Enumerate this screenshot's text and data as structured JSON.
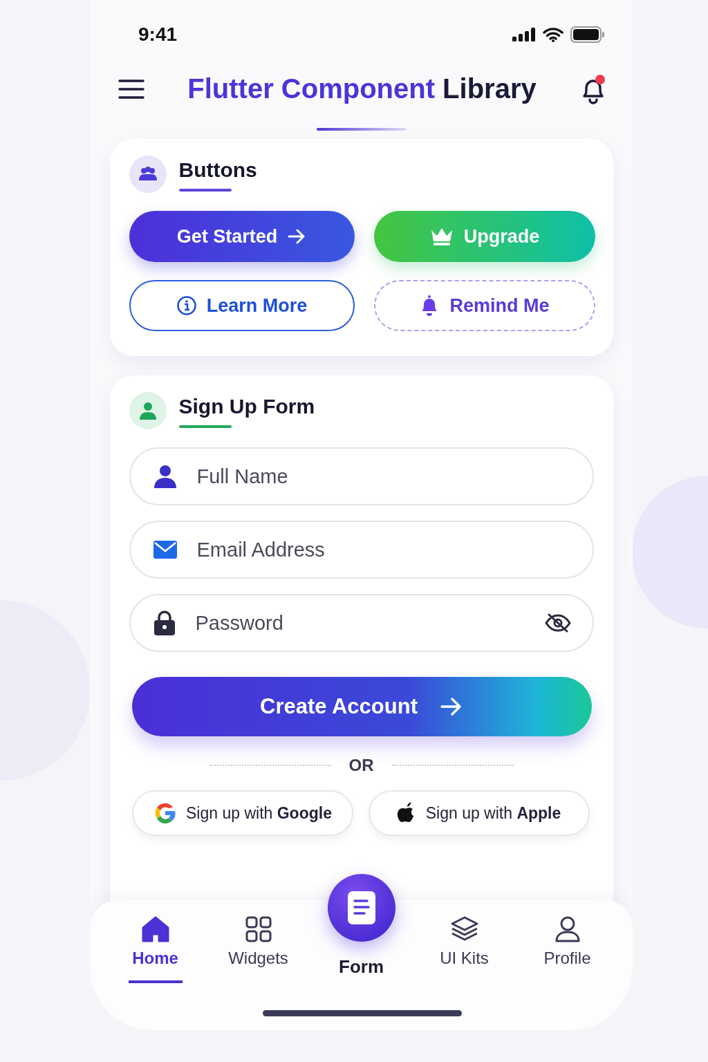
{
  "status_bar": {
    "time": "9:41"
  },
  "header": {
    "title_highlight": "Flutter Component",
    "title_rest": "Library",
    "has_notification": true
  },
  "buttons_card": {
    "title": "Buttons",
    "buttons": [
      {
        "kind": "primary",
        "label": "Get Started"
      },
      {
        "kind": "success",
        "label": "Upgrade"
      },
      {
        "kind": "outline",
        "label": "Learn More"
      },
      {
        "kind": "dashed",
        "label": "Remind Me"
      }
    ]
  },
  "signup_card": {
    "title": "Sign Up Form",
    "fields": [
      {
        "kind": "name",
        "placeholder": "Full Name"
      },
      {
        "kind": "email",
        "placeholder": "Email Address"
      },
      {
        "kind": "password",
        "placeholder": "Password"
      }
    ],
    "submit": "Create Account",
    "divider": "OR",
    "social": [
      {
        "kind": "google",
        "text": "Sign up with **Google**"
      },
      {
        "kind": "apple",
        "text": "Sign up with **Apple**"
      }
    ]
  },
  "bottom_nav": [
    {
      "kind": "home",
      "label": "Home",
      "selected": true
    },
    {
      "kind": "widgets",
      "label": "Widgets",
      "selected": false
    },
    {
      "kind": "fab",
      "label": "Form",
      "selected": false
    },
    {
      "kind": "kits",
      "label": "UI Kits",
      "selected": false
    },
    {
      "kind": "profile",
      "label": "Profile",
      "selected": false
    }
  ]
}
